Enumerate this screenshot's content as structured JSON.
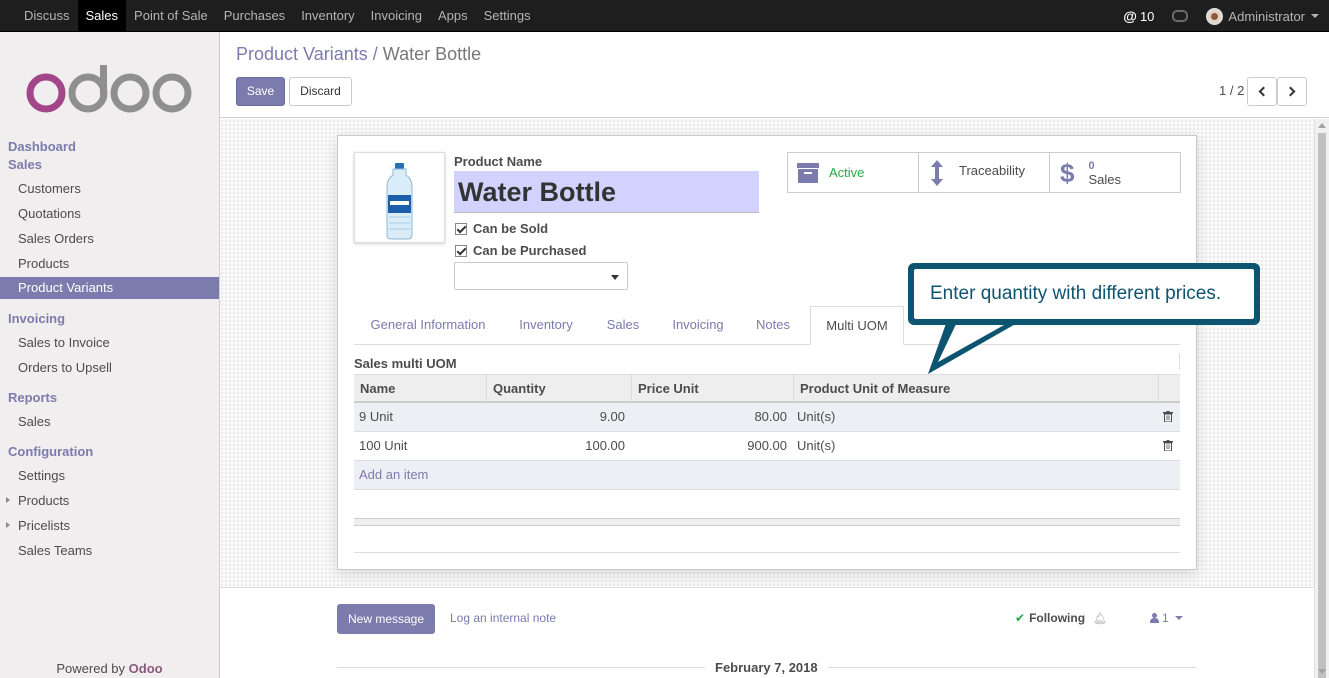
{
  "topbar": {
    "menu": [
      "Discuss",
      "Sales",
      "Point of Sale",
      "Purchases",
      "Inventory",
      "Invoicing",
      "Apps",
      "Settings"
    ],
    "active_menu": "Sales",
    "mentions": "10",
    "user": "Administrator"
  },
  "sidebar": {
    "sections": {
      "dashboard": "Dashboard",
      "sales": "Sales",
      "invoicing": "Invoicing",
      "reports": "Reports",
      "configuration": "Configuration"
    },
    "sales_items": [
      "Customers",
      "Quotations",
      "Sales Orders",
      "Products",
      "Product Variants"
    ],
    "invoicing_items": [
      "Sales to Invoice",
      "Orders to Upsell"
    ],
    "reports_items": [
      "Sales"
    ],
    "config_items": [
      "Settings",
      "Products",
      "Pricelists",
      "Sales Teams"
    ],
    "powered_prefix": "Powered by",
    "powered_brand": "Odoo"
  },
  "control_panel": {
    "breadcrumb_parent": "Product Variants",
    "breadcrumb_sep": "/",
    "breadcrumb_current": "Water Bottle",
    "save_label": "Save",
    "discard_label": "Discard",
    "pager": "1 / 2"
  },
  "form": {
    "product_name_label": "Product Name",
    "product_name": "Water Bottle",
    "can_be_sold": "Can be Sold",
    "can_be_purchased": "Can be Purchased",
    "smart_buttons": {
      "active": "Active",
      "traceability": "Traceability",
      "sales_count": "0",
      "sales_label": "Sales"
    },
    "tabs": [
      "General Information",
      "Inventory",
      "Sales",
      "Invoicing",
      "Notes",
      "Multi UOM"
    ],
    "active_tab": "Multi UOM",
    "section_title": "Sales multi UOM",
    "table": {
      "headers": [
        "Name",
        "Quantity",
        "Price Unit",
        "Product Unit of Measure"
      ],
      "rows": [
        {
          "name": "9 Unit",
          "quantity": "9.00",
          "price": "80.00",
          "uom": "Unit(s)"
        },
        {
          "name": "100 Unit",
          "quantity": "100.00",
          "price": "900.00",
          "uom": "Unit(s)"
        }
      ],
      "add_item": "Add an item"
    }
  },
  "callout": {
    "text": "Enter quantity with different prices."
  },
  "chatter": {
    "new_message": "New message",
    "log_note": "Log an internal note",
    "following": "Following",
    "followers": "1",
    "date": "February 7, 2018"
  },
  "colors": {
    "accent": "#7c7bad",
    "brand": "#875a7b",
    "callout": "#0d5470",
    "topbar": "#1e1e1e"
  }
}
